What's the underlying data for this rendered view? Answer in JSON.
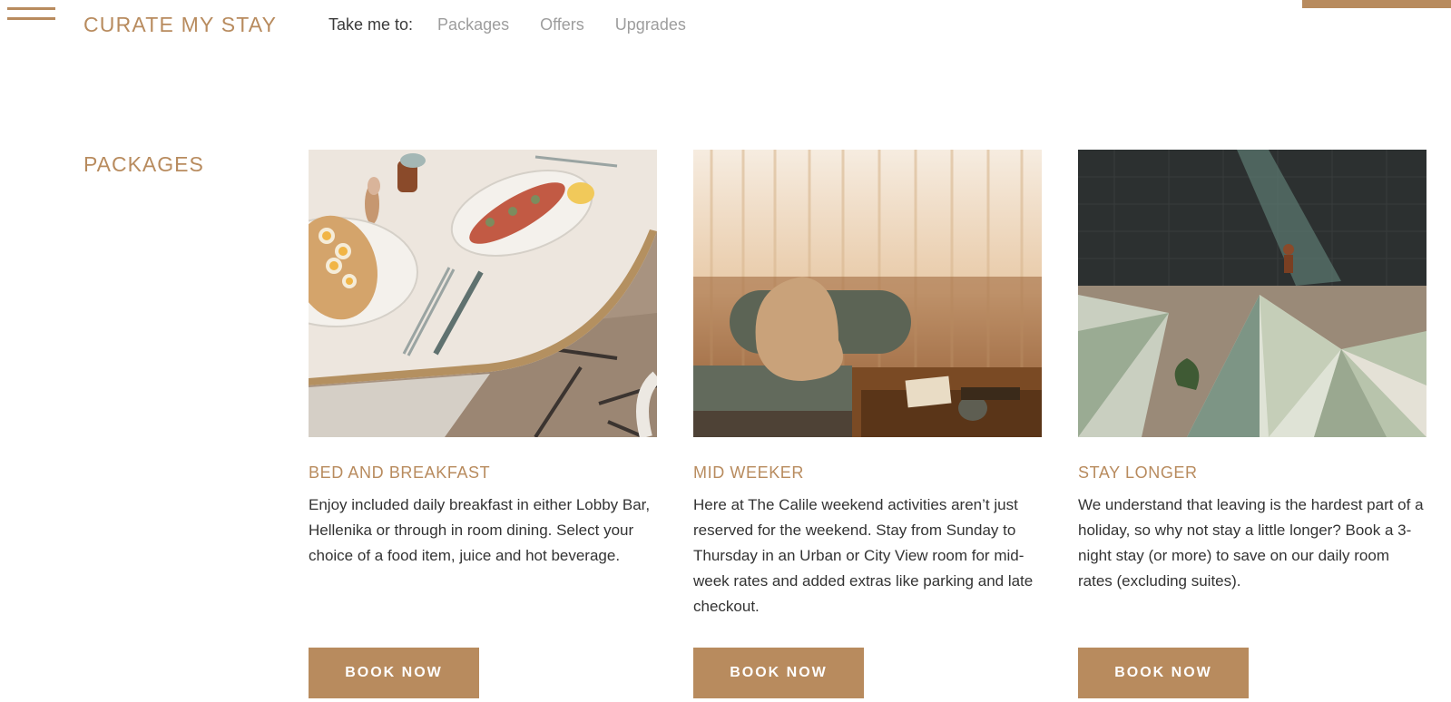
{
  "header": {
    "logo": "CURATE MY STAY",
    "nav_label": "Take me to:",
    "nav_links": [
      "Packages",
      "Offers",
      "Upgrades"
    ]
  },
  "packages": {
    "heading": "PACKAGES",
    "cards": [
      {
        "title": "BED AND BREAKFAST",
        "description": "Enjoy included daily breakfast in either Lobby Bar, Hellenika or through in room dining. Select your choice of a food item, juice and hot beverage.",
        "button": "BOOK NOW",
        "image": "breakfast-table-photo"
      },
      {
        "title": "MID WEEKER",
        "description": "Here at The Calile weekend activities aren’t just reserved for the weekend. Stay from Sunday to Thursday in an Urban or City View room for mid-week rates and added extras like parking and late checkout.",
        "button": "BOOK NOW",
        "image": "lounge-daybed-photo"
      },
      {
        "title": "STAY LONGER",
        "description": "We understand that leaving is the hardest part of a holiday, so why not stay a little longer? Book a 3-night stay (or more) to save on our daily room rates (excluding suites).",
        "button": "BOOK NOW",
        "image": "pool-umbrellas-photo"
      }
    ]
  },
  "colors": {
    "brand": "#b88b5e",
    "text": "#333333",
    "nav_muted": "#9d9d9d",
    "background": "#ffffff"
  }
}
